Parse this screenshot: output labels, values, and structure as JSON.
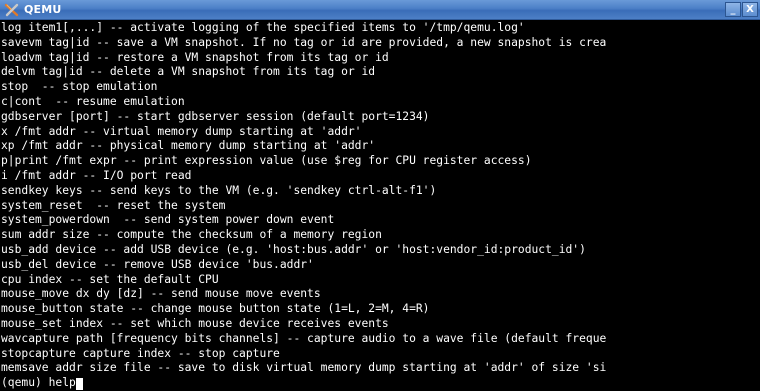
{
  "window": {
    "title": "QEMU",
    "minimize_label": "_",
    "close_label": "X"
  },
  "console": {
    "lines": [
      "log item1[,...] -- activate logging of the specified items to '/tmp/qemu.log'",
      "savevm tag|id -- save a VM snapshot. If no tag or id are provided, a new snapshot is crea",
      "loadvm tag|id -- restore a VM snapshot from its tag or id",
      "delvm tag|id -- delete a VM snapshot from its tag or id",
      "stop  -- stop emulation",
      "c|cont  -- resume emulation",
      "gdbserver [port] -- start gdbserver session (default port=1234)",
      "x /fmt addr -- virtual memory dump starting at 'addr'",
      "xp /fmt addr -- physical memory dump starting at 'addr'",
      "p|print /fmt expr -- print expression value (use $reg for CPU register access)",
      "i /fmt addr -- I/O port read",
      "sendkey keys -- send keys to the VM (e.g. 'sendkey ctrl-alt-f1')",
      "system_reset  -- reset the system",
      "system_powerdown  -- send system power down event",
      "sum addr size -- compute the checksum of a memory region",
      "usb_add device -- add USB device (e.g. 'host:bus.addr' or 'host:vendor_id:product_id')",
      "usb_del device -- remove USB device 'bus.addr'",
      "cpu index -- set the default CPU",
      "mouse_move dx dy [dz] -- send mouse move events",
      "mouse_button state -- change mouse button state (1=L, 2=M, 4=R)",
      "mouse_set index -- set which mouse device receives events",
      "wavcapture path [frequency bits channels] -- capture audio to a wave file (default freque",
      "stopcapture capture index -- stop capture",
      "memsave addr size file -- save to disk virtual memory dump starting at 'addr' of size 'si"
    ],
    "prompt": "(qemu) help"
  },
  "colors": {
    "background": "#000000",
    "text": "#ffffff",
    "titlebar": "#4b7fc7"
  },
  "icons": {
    "app": "qemu-app-icon",
    "minimize": "minimize-icon",
    "close": "close-icon"
  }
}
